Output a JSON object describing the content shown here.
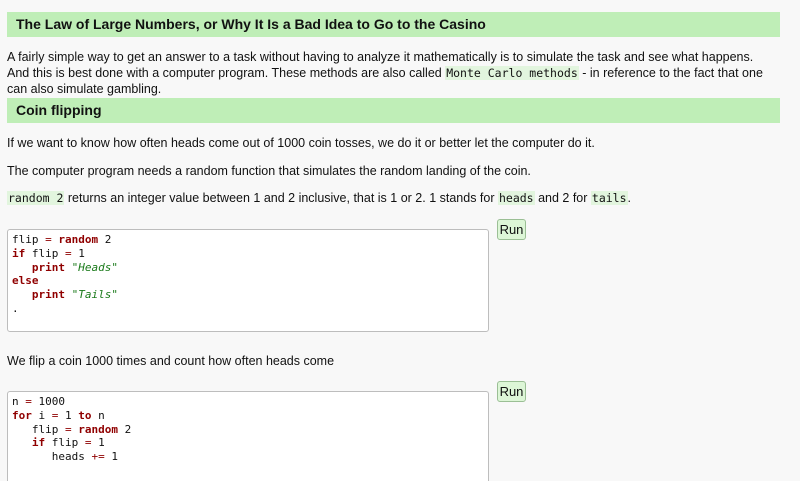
{
  "section1": {
    "heading": "The Law of Large Numbers, or Why It Is a Bad Idea to Go to the Casino",
    "intro_part1": "A fairly simple way to get an answer to a task without having to analyze it mathematically is to simulate the task and see what happens. And this is best done with a computer program. These methods are also called ",
    "intro_code": "Monte Carlo methods",
    "intro_part2": " - in reference to the fact that one can also simulate gambling."
  },
  "section2": {
    "heading": "Coin flipping",
    "para1": "If we want to know how often heads come out of 1000 coin tosses, we do it or better let the computer do it.",
    "para2": "The computer program needs a random function that simulates the random landing of the coin.",
    "para3_code1": "random 2",
    "para3_text1": " returns an integer value between 1 and 2 inclusive, that is 1 or 2. 1 stands for ",
    "para3_code2": "heads",
    "para3_text2": " and 2 for ",
    "para3_code3": "tails",
    "para3_text3": ".",
    "para4": "We flip a coin 1000 times and count how often heads come"
  },
  "editor1": {
    "line1_a": "flip ",
    "line1_op": "=",
    "line1_kw": " random",
    "line1_b": " 2",
    "line2_kw": "if",
    "line2_a": " flip ",
    "line2_op": "=",
    "line2_b": " 1",
    "line3_kw": "   print",
    "line3_str": " \"Heads\"",
    "line4_kw": "else",
    "line5_kw": "   print",
    "line5_str": " \"Tails\"",
    "line6": "."
  },
  "editor2": {
    "line1_a": "n ",
    "line1_op": "=",
    "line1_b": " 1000",
    "line2_kw": "for",
    "line2_a": " i ",
    "line2_op": "=",
    "line2_b": " 1 ",
    "line2_kw2": "to",
    "line2_c": " n",
    "line3_a": "   flip ",
    "line3_op": "=",
    "line3_kw": " random",
    "line3_b": " 2",
    "line4_kw": "   if",
    "line4_a": " flip ",
    "line4_op": "=",
    "line4_b": " 1",
    "line5_a": "      heads ",
    "line5_op": "+=",
    "line5_b": " 1"
  },
  "buttons": {
    "run1": "Run",
    "run2": "Run"
  }
}
